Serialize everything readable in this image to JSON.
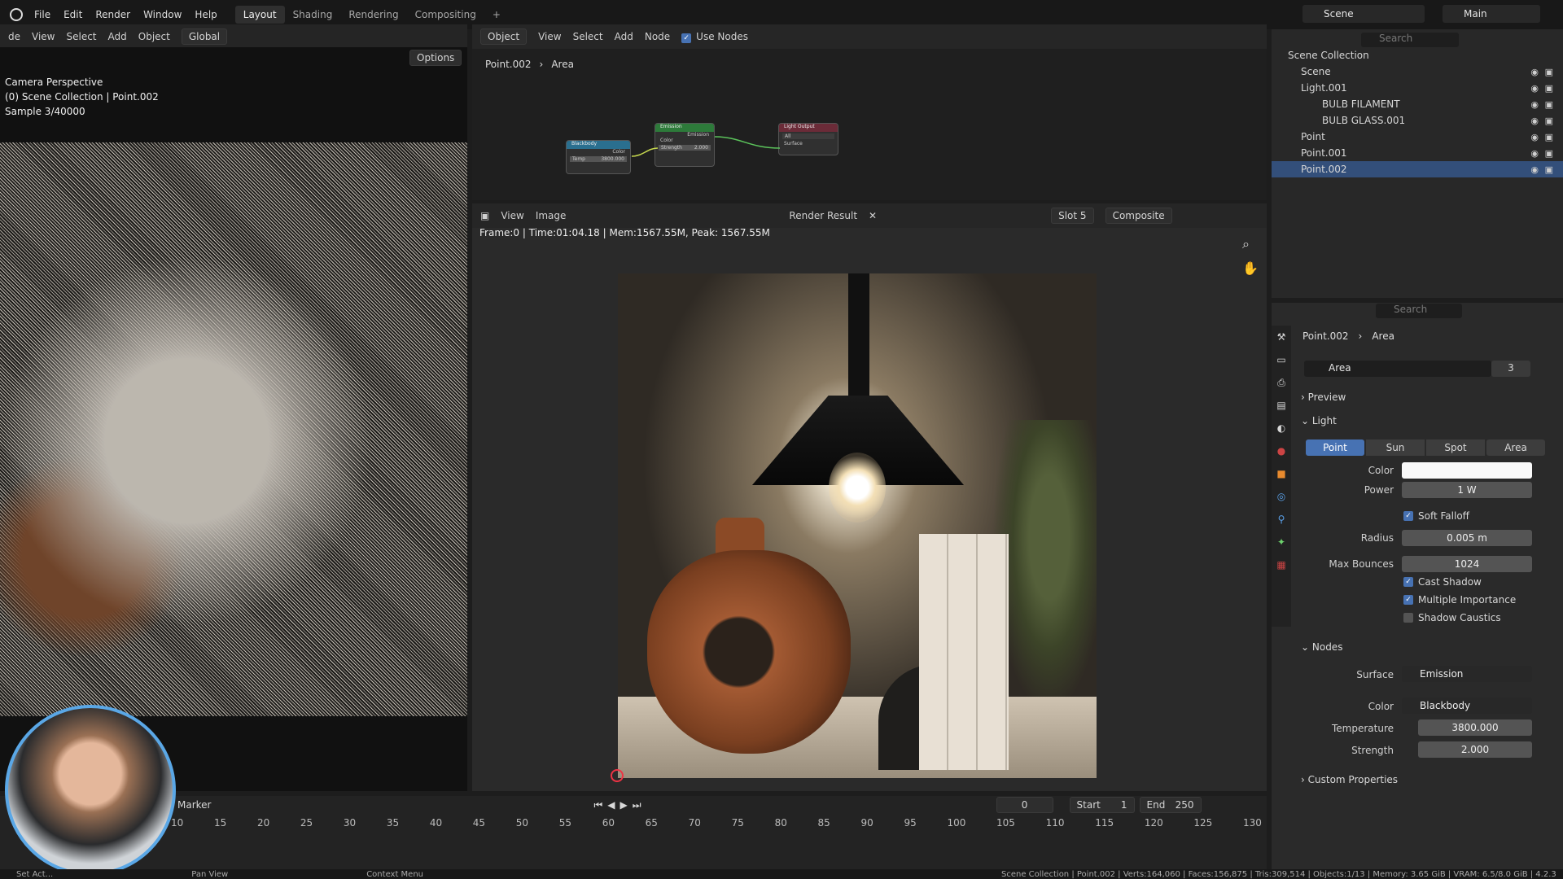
{
  "topbar": {
    "menus": [
      "File",
      "Edit",
      "Render",
      "Window",
      "Help"
    ],
    "workspaces": [
      "Layout",
      "Shading",
      "Rendering",
      "Compositing"
    ],
    "active_workspace": "Layout",
    "add_workspace": "+",
    "scene": "Scene",
    "view_layer": "Main"
  },
  "viewport3d": {
    "header": {
      "mode": "de",
      "view": "View",
      "select": "Select",
      "add": "Add",
      "object": "Object",
      "orientation": "Global",
      "options": "Options"
    },
    "overlay": {
      "line1": "Camera Perspective",
      "line2": "(0) Scene Collection | Point.002",
      "line3": "Sample 3/40000"
    }
  },
  "node_editor": {
    "header": {
      "type": "Object",
      "view": "View",
      "select": "Select",
      "add": "Add",
      "node": "Node",
      "use_nodes": "Use Nodes"
    },
    "breadcrumb": {
      "object": "Point.002",
      "light": "Area"
    },
    "nodes": {
      "blackbody": {
        "title": "Blackbody",
        "out": "Color",
        "temp": "Temp",
        "temp_val": "3800.000"
      },
      "emission": {
        "title": "Emission",
        "out": "Emission",
        "color": "Color",
        "strength": "Strength",
        "strength_val": "2.000"
      },
      "output": {
        "title": "Light Output",
        "target": "All",
        "surface": "Surface"
      }
    }
  },
  "image_editor": {
    "header": {
      "view": "View",
      "image": "Image",
      "image_name": "Render Result",
      "slot": "Slot 5",
      "pass": "Composite"
    },
    "info": "Frame:0 | Time:01:04.18 | Mem:1567.55M, Peak: 1567.55M"
  },
  "outliner": {
    "search_placeholder": "Search",
    "rows": [
      {
        "name": "Scene Collection",
        "indent": 0
      },
      {
        "name": "Scene",
        "indent": 1
      },
      {
        "name": "Light.001",
        "indent": 1
      },
      {
        "name": "BULB FILAMENT",
        "indent": 2
      },
      {
        "name": "BULB GLASS.001",
        "indent": 2
      },
      {
        "name": "Point",
        "indent": 1
      },
      {
        "name": "Point.001",
        "indent": 1
      },
      {
        "name": "Point.002",
        "indent": 1
      }
    ]
  },
  "properties": {
    "search_placeholder": "Search",
    "breadcrumb": {
      "object": "Point.002",
      "light": "Area"
    },
    "datablock": {
      "name": "Area",
      "users": "3"
    },
    "sections": {
      "preview": "Preview",
      "light": "Light",
      "nodes": "Nodes",
      "custom": "Custom Properties"
    },
    "light_types": [
      "Point",
      "Sun",
      "Spot",
      "Area"
    ],
    "active_type": "Point",
    "color_label": "Color",
    "power_label": "Power",
    "power": "1 W",
    "soft_falloff": "Soft Falloff",
    "radius_label": "Radius",
    "radius": "0.005 m",
    "max_bounces_label": "Max Bounces",
    "max_bounces": "1024",
    "cast_shadow": "Cast Shadow",
    "multiple_importance": "Multiple Importance",
    "shadow_caustics": "Shadow Caustics",
    "surface_label": "Surface",
    "surface": "Emission",
    "node_color_label": "Color",
    "node_color": "Blackbody",
    "temperature_label": "Temperature",
    "temperature": "3800.000",
    "strength_label": "Strength",
    "strength": "2.000"
  },
  "timeline": {
    "marker": "Marker",
    "current_frame": "0",
    "start_label": "Start",
    "start": "1",
    "end_label": "End",
    "end": "250",
    "ticks": [
      "10",
      "15",
      "20",
      "25",
      "30",
      "35",
      "40",
      "45",
      "50",
      "55",
      "60",
      "65",
      "70",
      "75",
      "80",
      "85",
      "90",
      "95",
      "100",
      "105",
      "110",
      "115",
      "120",
      "125",
      "130"
    ]
  },
  "statusbar": {
    "select": "Set Act...",
    "pan": "Pan View",
    "context": "Context Menu",
    "stats": "Scene Collection | Point.002 | Verts:164,060 | Faces:156,875 | Tris:309,514 | Objects:1/13 | Memory: 3.65 GiB | VRAM: 6.5/8.0 GiB | 4.2.3"
  },
  "colors": {
    "accent": "#4772b3",
    "selection": "#334f7a",
    "panel": "#2a2a2a"
  }
}
